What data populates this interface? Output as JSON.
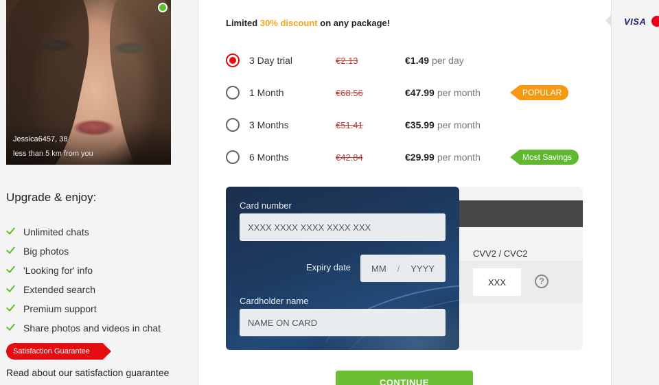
{
  "profile": {
    "name_age": "Jessica6457, 38",
    "distance": "less than 5 km from you"
  },
  "upgrade": {
    "title": "Upgrade & enjoy:",
    "features": [
      "Unlimited chats",
      "Big photos",
      "'Looking for' info",
      "Extended search",
      "Premium support",
      "Share photos and videos in chat"
    ],
    "badge": "Satisfaction Guarantee",
    "read_more": "Read about our satisfaction guarantee"
  },
  "offer": {
    "prefix": "Limited ",
    "discount": "30% discount",
    "suffix": " on any package!"
  },
  "packages": [
    {
      "label": "3 Day trial",
      "old_price": "€2.13",
      "price": "€1.49",
      "per": "per day",
      "selected": true,
      "tag": ""
    },
    {
      "label": "1 Month",
      "old_price": "€68.56",
      "price": "€47.99",
      "per": "per month",
      "selected": false,
      "tag": "POPULAR"
    },
    {
      "label": "3 Months",
      "old_price": "€51.41",
      "price": "€35.99",
      "per": "per month",
      "selected": false,
      "tag": ""
    },
    {
      "label": "6 Months",
      "old_price": "€42.84",
      "price": "€29.99",
      "per": "per month",
      "selected": false,
      "tag": "Most Savings"
    }
  ],
  "card": {
    "number_label": "Card number",
    "number_placeholder": "XXXX XXXX XXXX XXXX XXX",
    "expiry_label": "Expiry date",
    "expiry_month": "MM",
    "expiry_sep": "/",
    "expiry_year": "YYYY",
    "holder_label": "Cardholder name",
    "holder_placeholder": "NAME ON CARD",
    "cvv_label": "CVV2 / CVC2",
    "cvv_placeholder": "XXX",
    "help": "?"
  },
  "continue_label": "CONTINUE",
  "payment_logos": {
    "visa": "VISA"
  },
  "colors": {
    "accent_red": "#e30d12",
    "discount_orange": "#f5a41a",
    "green": "#6cbf32",
    "popular": "#f59a12"
  }
}
